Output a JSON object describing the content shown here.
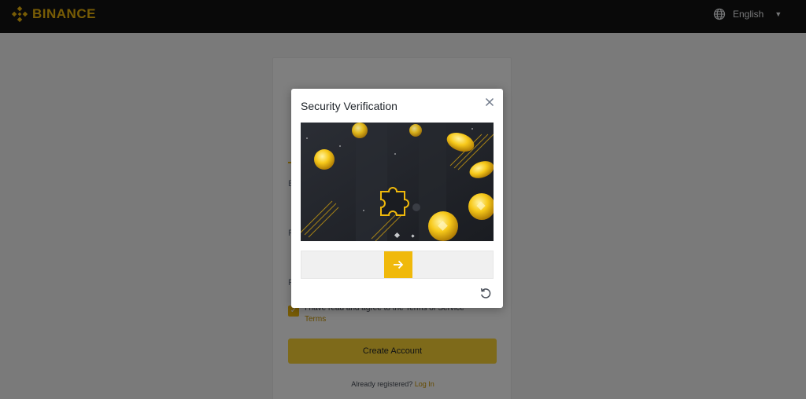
{
  "header": {
    "brand": "BINANCE",
    "language": "English",
    "colors": {
      "background": "#121212",
      "brand": "#f0b90b"
    },
    "icons": [
      "binance-logo-icon",
      "globe-icon",
      "caret-down-icon"
    ]
  },
  "register_form": {
    "field_labels": [
      "E",
      "P",
      "R"
    ],
    "terms_text": "I have read and agree to the Terms of Service",
    "terms_link": "Terms",
    "create_button": "Create Account",
    "already_registered": "Already registered?",
    "login_link": "Log In"
  },
  "modal": {
    "title": "Security Verification",
    "icons": [
      "close-icon",
      "puzzle-image",
      "arrow-right-icon",
      "refresh-icon"
    ],
    "accent_color": "#f0b90b"
  }
}
